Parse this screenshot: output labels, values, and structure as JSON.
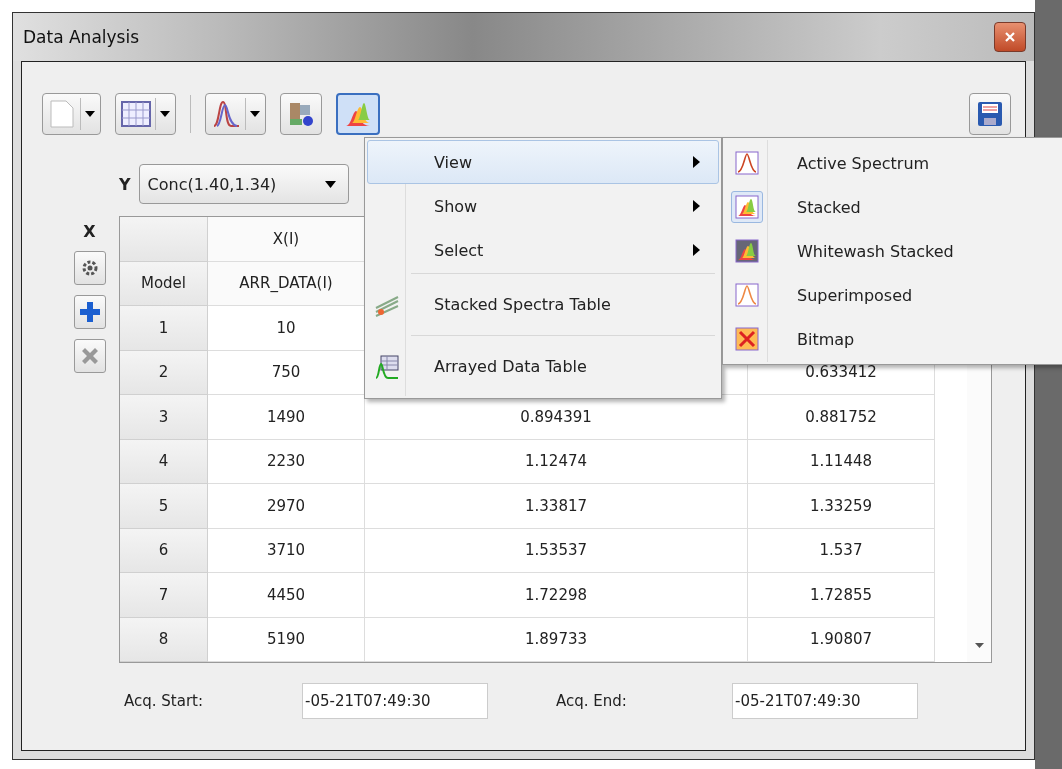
{
  "window": {
    "title": "Data Analysis"
  },
  "y_axis": {
    "label": "Y",
    "value": "Conc(1.40,1.34)"
  },
  "x_axis": {
    "label": "X"
  },
  "table": {
    "header_rows": [
      [
        null,
        "X(I)",
        null,
        null
      ],
      [
        "Model",
        "ARR_DATA(I)",
        null,
        null
      ]
    ],
    "rows": [
      [
        "1",
        "10",
        null,
        null
      ],
      [
        "2",
        "750",
        null,
        "0.633412"
      ],
      [
        "3",
        "1490",
        "0.894391",
        "0.881752"
      ],
      [
        "4",
        "2230",
        "1.12474",
        "1.11448"
      ],
      [
        "5",
        "2970",
        "1.33817",
        "1.33259"
      ],
      [
        "6",
        "3710",
        "1.53537",
        "1.537"
      ],
      [
        "7",
        "4450",
        "1.72298",
        "1.72855"
      ],
      [
        "8",
        "5190",
        "1.89733",
        "1.90807"
      ]
    ]
  },
  "acq_start": {
    "label": "Acq. Start:",
    "value": "-05-21T07:49:30"
  },
  "acq_end": {
    "label": "Acq. End:",
    "value": "-05-21T07:49:30"
  },
  "menu": [
    {
      "kind": "submenu",
      "label": "View",
      "selected": true
    },
    {
      "kind": "submenu",
      "label": "Show",
      "selected": false
    },
    {
      "kind": "submenu",
      "label": "Select",
      "selected": false
    },
    {
      "kind": "separator"
    },
    {
      "kind": "action",
      "label": "Stacked Spectra Table",
      "selected": false
    },
    {
      "kind": "separator"
    },
    {
      "kind": "action",
      "label": "Arrayed Data Table",
      "selected": false
    }
  ],
  "submenu": [
    {
      "label": "Active Spectrum",
      "selected": false
    },
    {
      "label": "Stacked",
      "selected": true
    },
    {
      "label": "Whitewash Stacked",
      "selected": false
    },
    {
      "label": "Superimposed",
      "selected": false
    },
    {
      "label": "Bitmap",
      "selected": false
    }
  ]
}
